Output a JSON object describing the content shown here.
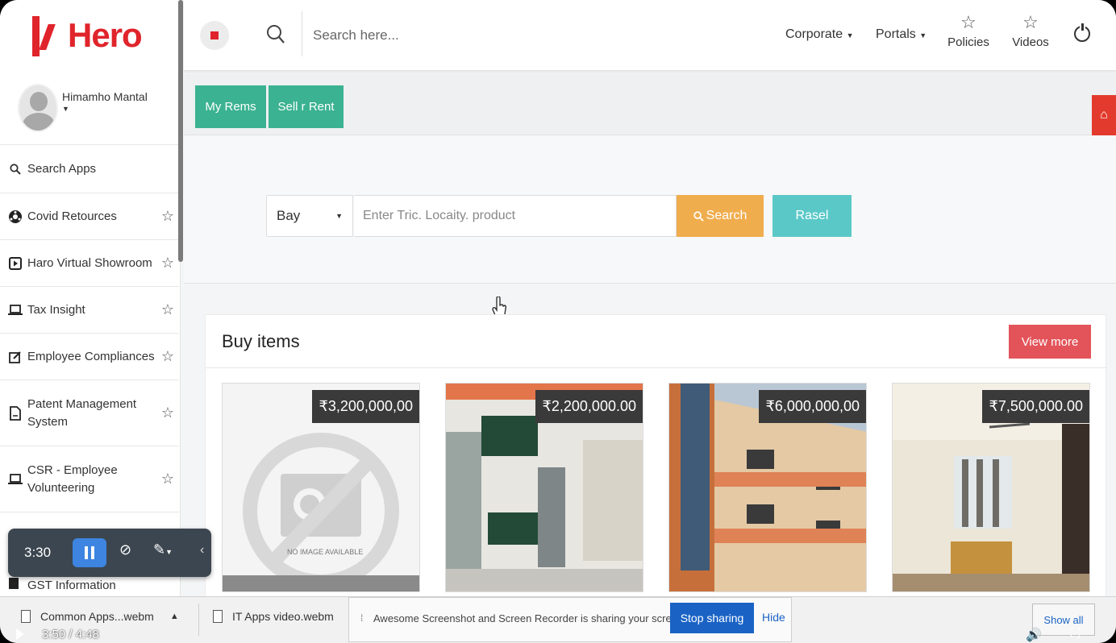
{
  "brand": {
    "name": "Hero",
    "color": "#e0242b"
  },
  "profile": {
    "name": "Himamho Mantal"
  },
  "sidebar": {
    "search_label": "Search Apps",
    "items": [
      {
        "label": "Covid Retources",
        "icon": "virus-icon"
      },
      {
        "label": "Haro Virtual Showroom",
        "icon": "video-icon"
      },
      {
        "label": "Tax Insight",
        "icon": "laptop-icon"
      },
      {
        "label": "Employee Compliances",
        "icon": "edit-icon"
      },
      {
        "label": "Patent Management System",
        "icon": "document-icon"
      },
      {
        "label": "CSR - Employee Volunteering",
        "icon": "laptop-icon"
      },
      {
        "label": "GST Information",
        "icon": "document-icon"
      }
    ]
  },
  "header": {
    "search_placeholder": "Search here...",
    "nav": [
      {
        "label": "Corporate"
      },
      {
        "label": "Portals"
      }
    ],
    "policies_label": "Policies",
    "videos_label": "Videos"
  },
  "tabs": {
    "my_items": "My Rems",
    "sell_rent": "Sell r Rent"
  },
  "search_panel": {
    "mode": "Bay",
    "query_placeholder": "Enter Tric. Locaity. product",
    "search_label": "Search",
    "reset_label": "Rasel"
  },
  "buy": {
    "title": "Buy items",
    "view_more": "View more",
    "items": [
      {
        "price": "₹3,200,000,00",
        "image_text": "NO IMAGE AVAILABLE"
      },
      {
        "price": "₹2,200,000.00"
      },
      {
        "price": "₹6,000,000,00"
      },
      {
        "price": "₹7,500,000.00"
      }
    ]
  },
  "recorder": {
    "time": "3:30"
  },
  "downloads": {
    "file1": "Common Apps...webm",
    "file2": "IT Apps video.webm",
    "share_message": "Awesome Screenshot and Screen Recorder is sharing your screen.",
    "stop_label": "Stop sharing",
    "hide_label": "Hide",
    "show_all_label": "Show all"
  },
  "player": {
    "time": "3:50 / 4:48"
  },
  "colors": {
    "green_tab": "#3bb291",
    "search_btn": "#f0ad4e",
    "reset_btn": "#5bc8c8",
    "view_more": "#e3545a",
    "stop_btn": "#1a63c5"
  }
}
